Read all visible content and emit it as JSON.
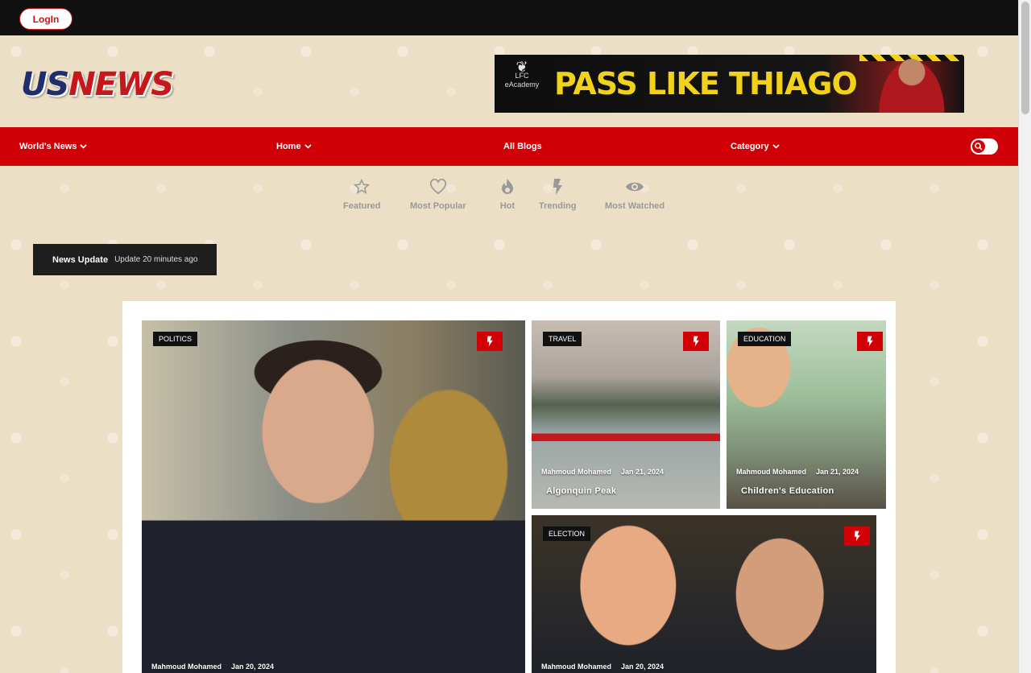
{
  "topbar": {
    "login_label": "LogIn"
  },
  "logo": {
    "part1": "US",
    "part2": "NEWS"
  },
  "ad": {
    "crest_line1": "LFC",
    "crest_line2": "eAcademy",
    "text_white": "PASS LIKE ",
    "text_yellow": "THIAGO"
  },
  "nav": {
    "items": [
      {
        "label": "World's News",
        "dropdown": true
      },
      {
        "label": "Home",
        "dropdown": true
      },
      {
        "label": "All Blogs",
        "dropdown": false
      },
      {
        "label": "Category",
        "dropdown": true
      }
    ],
    "search_icon": "search-icon"
  },
  "filters": [
    {
      "label": "Featured",
      "icon": "star-icon"
    },
    {
      "label": "Most Popular",
      "icon": "heart-icon"
    },
    {
      "label": "Hot",
      "icon": "flame-icon"
    },
    {
      "label": "Trending",
      "icon": "lightning-icon"
    },
    {
      "label": "Most Watched",
      "icon": "eye-icon"
    }
  ],
  "news_update": {
    "title": "News Update",
    "subtitle": "Update 20 minutes ago"
  },
  "cards": [
    {
      "tag": "POLITICS",
      "author": "Mahmoud Mohamed",
      "date": "Jan 20, 2024",
      "title": ""
    },
    {
      "tag": "TRAVEL",
      "author": "Mahmoud Mohamed",
      "date": "Jan 21, 2024",
      "title": "Algonquin Peak"
    },
    {
      "tag": "EDUCATION",
      "author": "Mahmoud Mohamed",
      "date": "Jan 21, 2024",
      "title": "Children's Education"
    },
    {
      "tag": "ELECTION",
      "author": "Mahmoud Mohamed",
      "date": "Jan 20, 2024",
      "title": ""
    }
  ],
  "colors": {
    "brand_red": "#d10006",
    "background": "#ebdfc6",
    "topbar": "#111111"
  }
}
